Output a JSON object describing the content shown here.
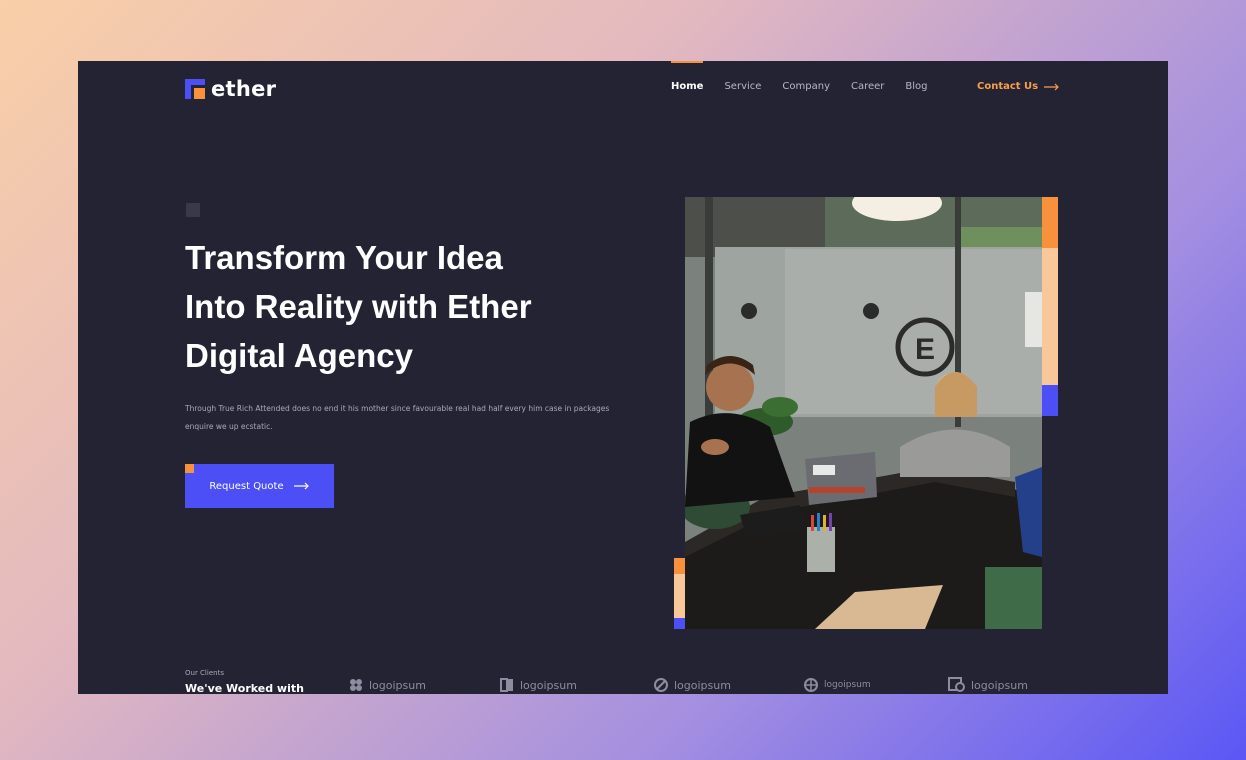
{
  "brand": {
    "name": "ether"
  },
  "nav": {
    "items": [
      {
        "label": "Home",
        "active": true
      },
      {
        "label": "Service",
        "active": false
      },
      {
        "label": "Company",
        "active": false
      },
      {
        "label": "Career",
        "active": false
      },
      {
        "label": "Blog",
        "active": false
      }
    ],
    "contact_label": "Contact Us",
    "contact_icon": "arrow-right-icon"
  },
  "hero": {
    "title_line1": "Transform Your Idea",
    "title_line2": "Into Reality with Ether",
    "title_line3": "Digital Agency",
    "subtitle": "Through True Rich Attended does no end it his mother since favourable real had half every him case in packages enquire we up ecstatic.",
    "cta_label": "Request Quote",
    "cta_icon": "arrow-right-icon"
  },
  "clients": {
    "eyebrow": "Our Clients",
    "heading": "We've Worked with",
    "logos": [
      "logoipsum",
      "logoipsum",
      "logoipsum",
      "logoipsum",
      "logoipsum"
    ]
  },
  "colors": {
    "background": "#242334",
    "accent_blue": "#4b4ff5",
    "accent_orange": "#f7913d",
    "accent_peach": "#f9c89a"
  }
}
